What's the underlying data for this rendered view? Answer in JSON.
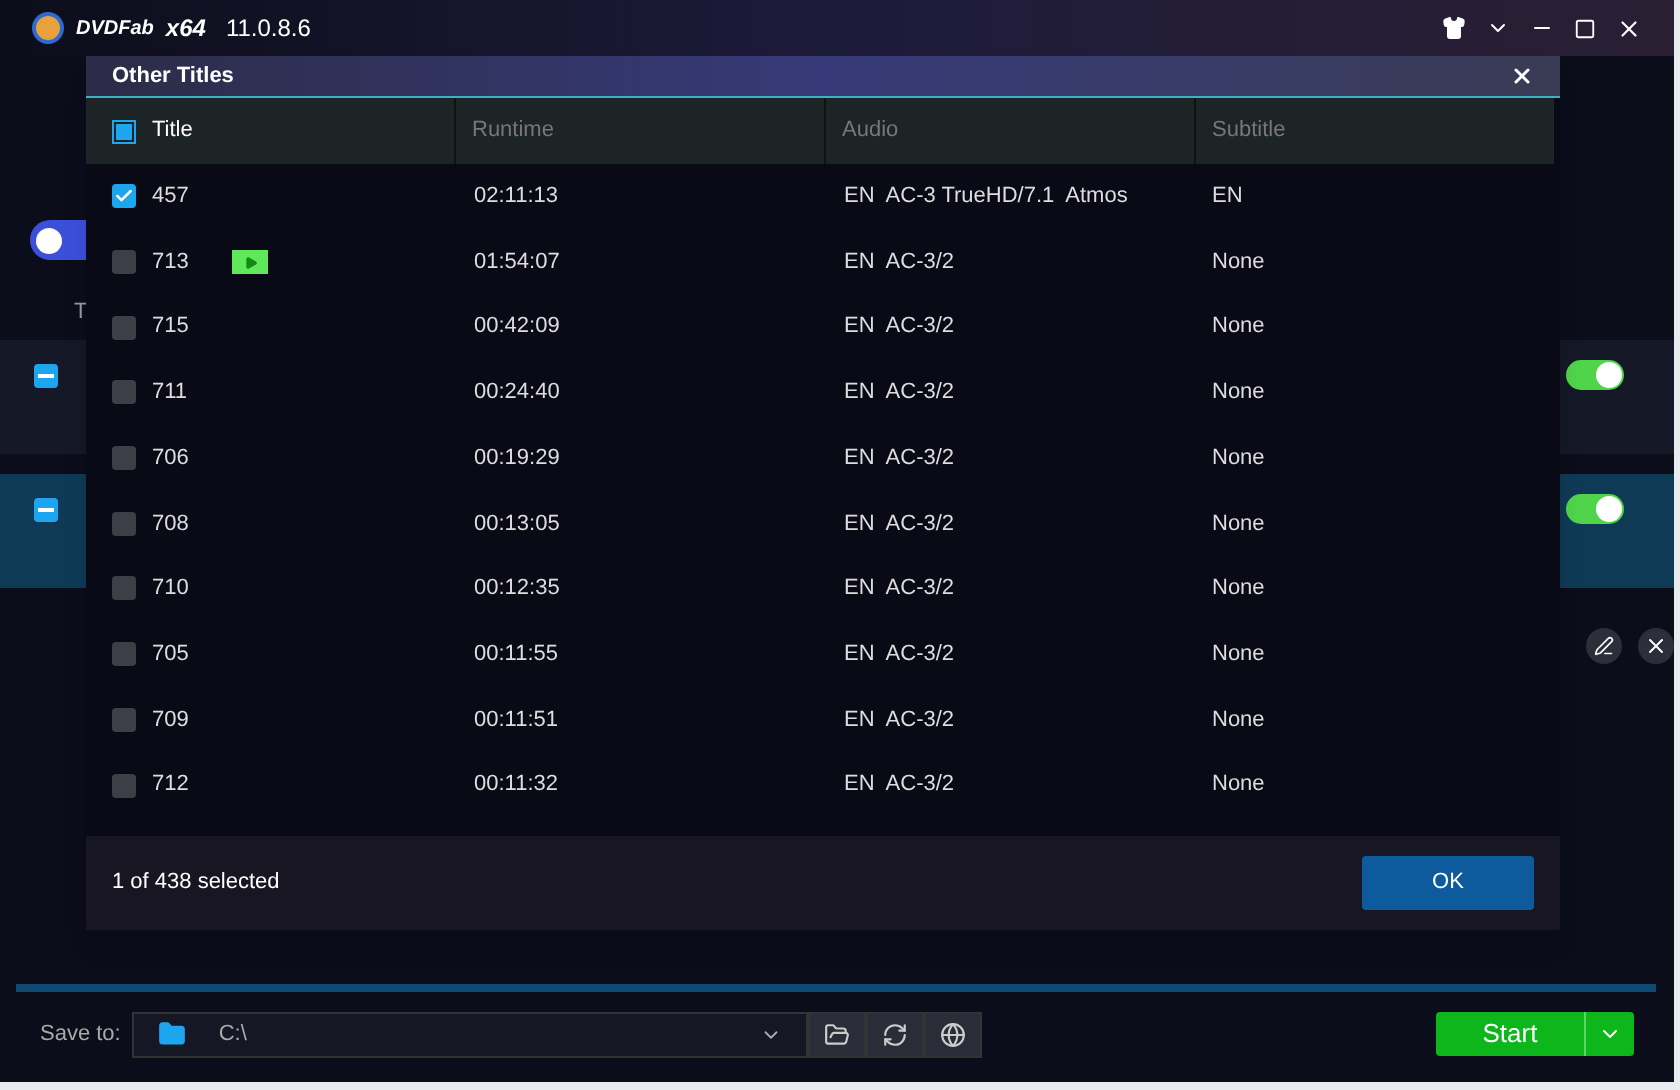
{
  "window": {
    "brand": "DVDFab",
    "arch": "x64",
    "version": "11.0.8.6"
  },
  "background": {
    "list_header": "T",
    "items": [
      {
        "on": true,
        "selected": false
      },
      {
        "on": true,
        "selected": true
      }
    ]
  },
  "dialog": {
    "title": "Other Titles",
    "indeterminate": true,
    "columns": [
      "Title",
      "Runtime",
      "Audio",
      "Subtitle"
    ],
    "rows": [
      {
        "title": "457",
        "runtime": "02:11:13",
        "audio": "EN  AC-3 TrueHD/7.1  Atmos",
        "subtitle": "EN",
        "checked": true,
        "preview": false
      },
      {
        "title": "713",
        "runtime": "01:54:07",
        "audio": "EN  AC-3/2",
        "subtitle": "None",
        "checked": false,
        "preview": true
      },
      {
        "title": "715",
        "runtime": "00:42:09",
        "audio": "EN  AC-3/2",
        "subtitle": "None",
        "checked": false,
        "preview": false
      },
      {
        "title": "711",
        "runtime": "00:24:40",
        "audio": "EN  AC-3/2",
        "subtitle": "None",
        "checked": false,
        "preview": false
      },
      {
        "title": "706",
        "runtime": "00:19:29",
        "audio": "EN  AC-3/2",
        "subtitle": "None",
        "checked": false,
        "preview": false
      },
      {
        "title": "708",
        "runtime": "00:13:05",
        "audio": "EN  AC-3/2",
        "subtitle": "None",
        "checked": false,
        "preview": false
      },
      {
        "title": "710",
        "runtime": "00:12:35",
        "audio": "EN  AC-3/2",
        "subtitle": "None",
        "checked": false,
        "preview": false
      },
      {
        "title": "705",
        "runtime": "00:11:55",
        "audio": "EN  AC-3/2",
        "subtitle": "None",
        "checked": false,
        "preview": false
      },
      {
        "title": "709",
        "runtime": "00:11:51",
        "audio": "EN  AC-3/2",
        "subtitle": "None",
        "checked": false,
        "preview": false
      },
      {
        "title": "712",
        "runtime": "00:11:32",
        "audio": "EN  AC-3/2",
        "subtitle": "None",
        "checked": false,
        "preview": false
      }
    ],
    "status": "1 of 438 selected",
    "ok": "OK"
  },
  "save_bar": {
    "label": "Save to:",
    "path": "C:\\",
    "start": "Start"
  }
}
